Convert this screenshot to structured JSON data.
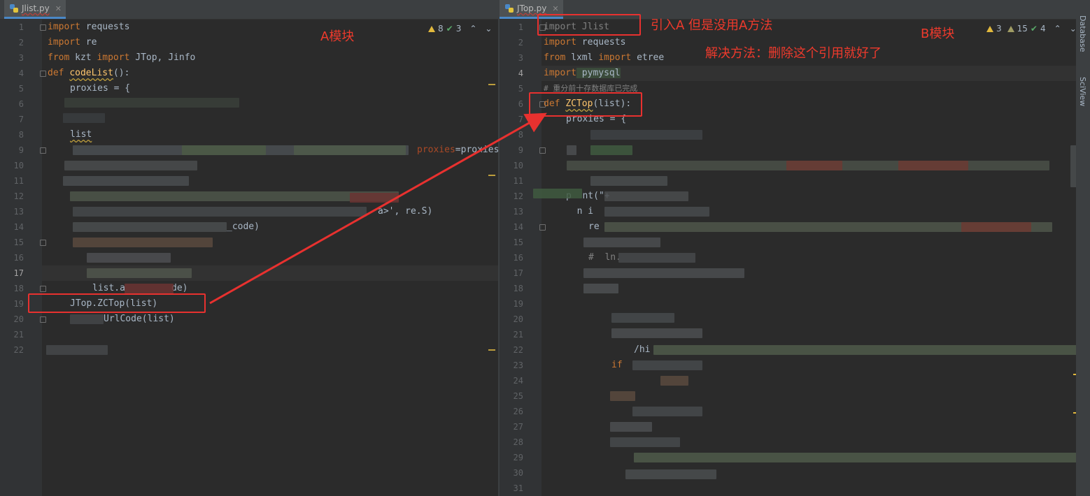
{
  "left": {
    "tab": {
      "filename": "Jlist.py"
    },
    "inspections": {
      "warnings": "8",
      "weak_warnings": "3"
    },
    "line_numbers": [
      "1",
      "2",
      "3",
      "4",
      "5",
      "6",
      "7",
      "8",
      "9",
      "10",
      "11",
      "12",
      "13",
      "14",
      "15",
      "16",
      "17",
      "18",
      "19",
      "20",
      "21",
      "22"
    ],
    "code": {
      "l1_kw": "import",
      "l1_rest": " requests",
      "l2_kw": "import",
      "l2_rest": " re",
      "l3_kw1": "from",
      "l3_mod": " kzt ",
      "l3_kw2": "import",
      "l3_rest": " JTop, Jinfo",
      "l4_kw": "def",
      "l4_fn": "codeList",
      "l4_rest": "():",
      "l5": "proxies = {",
      "l8": "list",
      "l9_tail": "proxies=proxies",
      "l13_tail": "a>', re.S)",
      "l14_tail": "_code)",
      "l18": "list.a",
      "l18_tail": "de)",
      "l19": "JTop.ZCTop(list)",
      "l20": "UrlCode(list)"
    }
  },
  "right": {
    "tab": {
      "filename": "JTop.py"
    },
    "inspections": {
      "warnings": "3",
      "weak_warnings": "15",
      "ok": "4"
    },
    "line_numbers": [
      "1",
      "2",
      "3",
      "4",
      "5",
      "6",
      "7",
      "8",
      "9",
      "10",
      "11",
      "12",
      "13",
      "14",
      "15",
      "16",
      "17",
      "18",
      "19",
      "20",
      "21",
      "22",
      "23",
      "24",
      "25",
      "26",
      "27",
      "28",
      "29",
      "30",
      "31"
    ],
    "code": {
      "l1": "import Jlist",
      "l2_kw": "import",
      "l2_rest": " requests",
      "l3_kw1": "from",
      "l3_mod": " lxml ",
      "l3_kw2": "import",
      "l3_rest": " etree",
      "l4_kw": "import",
      "l4_rest": " pymysql",
      "l5_comment": "# 重分前十存数据库已完成",
      "l6_kw": "def",
      "l6_fn": "ZCTop",
      "l6_rest": "(list):",
      "l7": "proxies = {",
      "l12": "p  nt(\"+",
      "l13": "  n i",
      "l14": "re",
      "l16": "#  ln.",
      "l22": "/hi",
      "l23": "if"
    },
    "side_tools": [
      "Database",
      "SciView"
    ]
  },
  "annotations": {
    "label_a": "A模块",
    "label_b": "B模块",
    "note_import": "引入A 但是没用A方法",
    "note_fix": "解决方法：删除这个引用就好了"
  },
  "colors": {
    "annotation_red": "#e8312f",
    "keyword": "#cc7832",
    "function": "#ffc66d",
    "text": "#a9b7c6"
  }
}
